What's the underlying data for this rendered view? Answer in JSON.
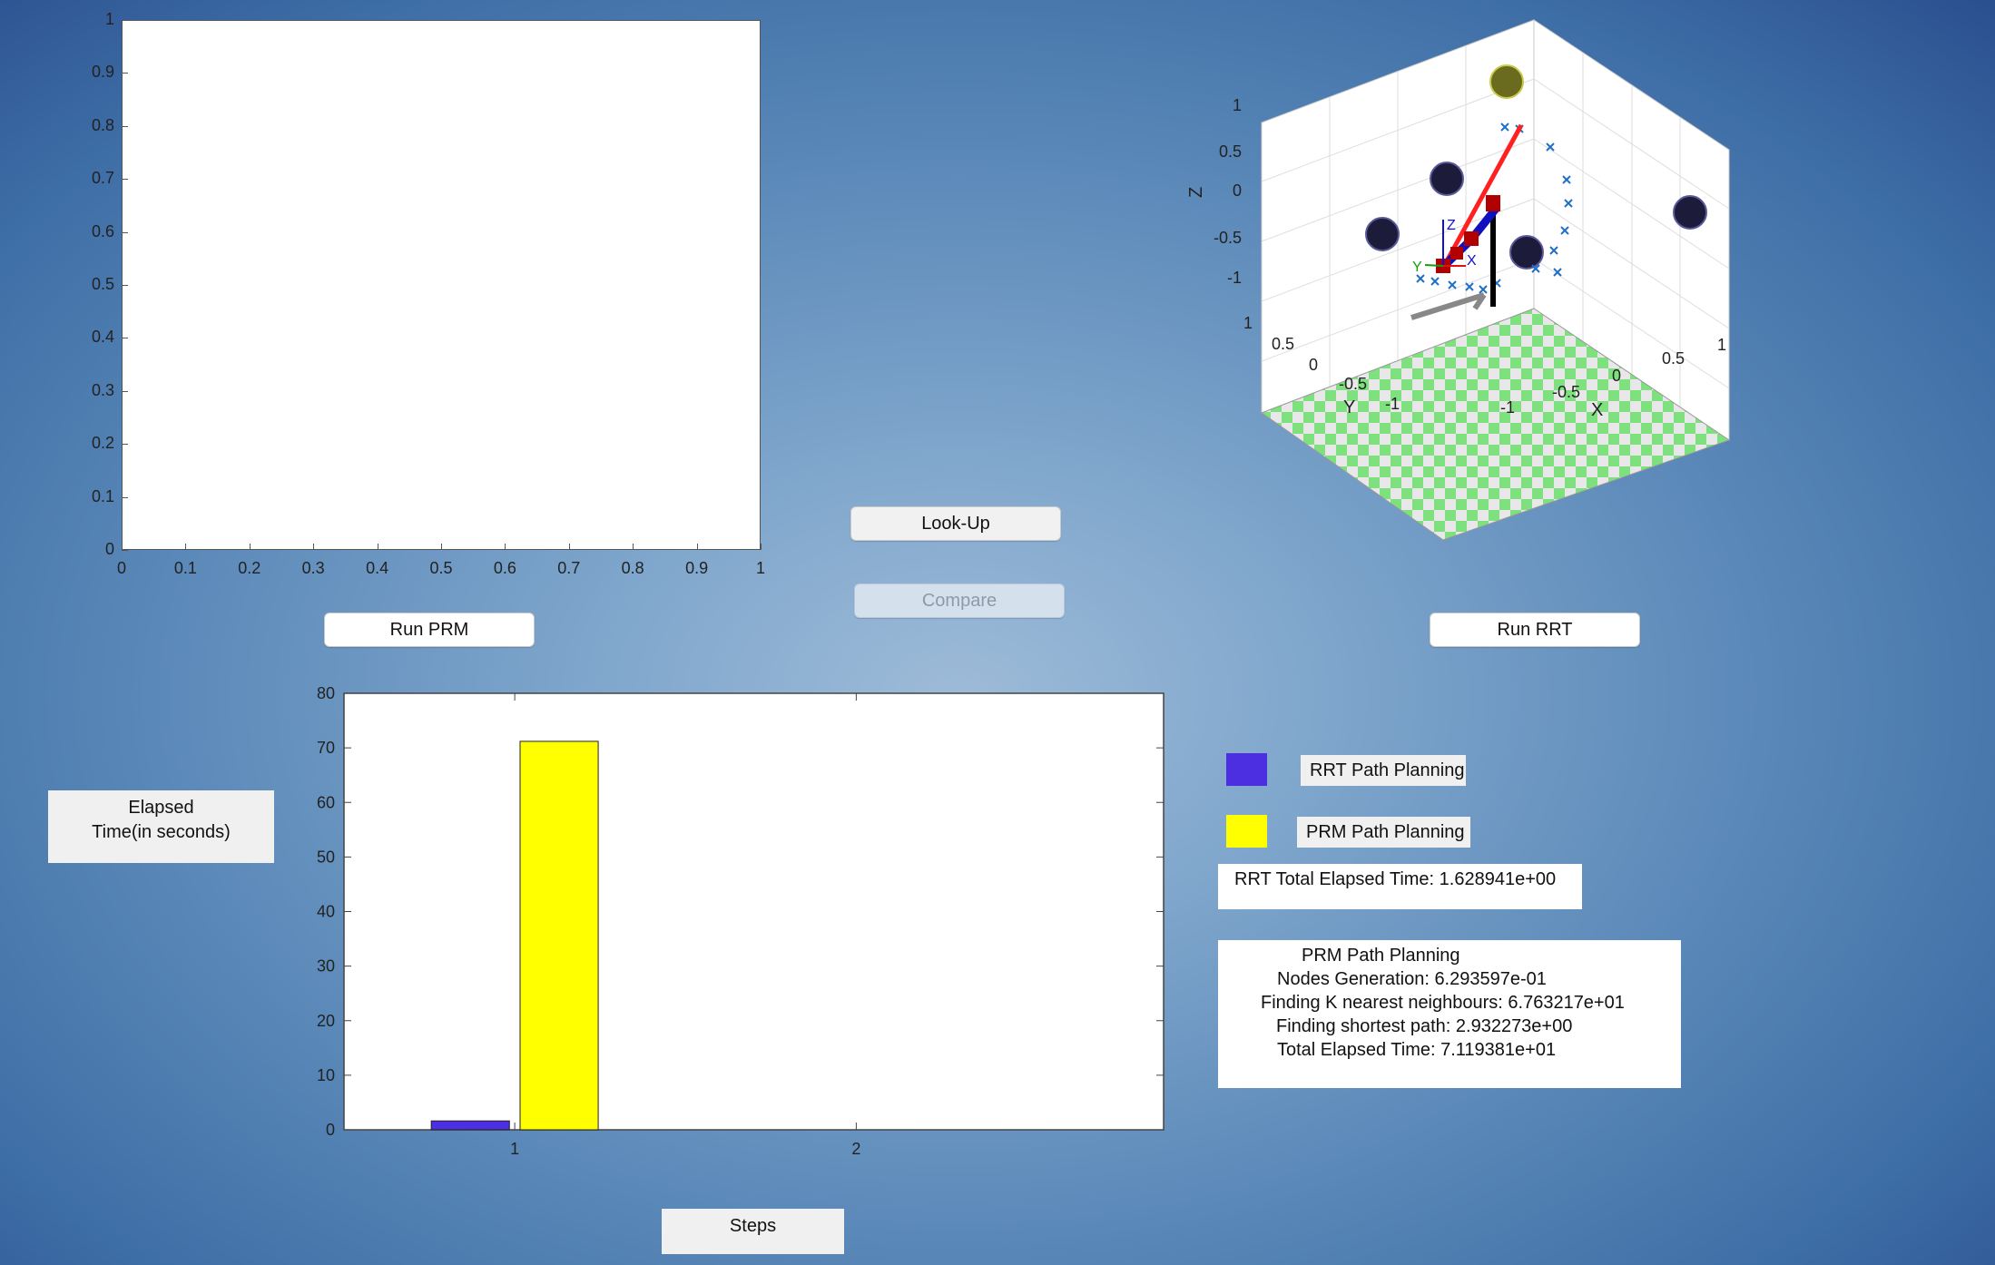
{
  "top_axes": {
    "chart_data": {
      "type": "line",
      "xlim": [
        0,
        1
      ],
      "ylim": [
        0,
        1
      ],
      "xticks": [
        "0",
        "0.1",
        "0.2",
        "0.3",
        "0.4",
        "0.5",
        "0.6",
        "0.7",
        "0.8",
        "0.9",
        "1"
      ],
      "yticks": [
        "0",
        "0.1",
        "0.2",
        "0.3",
        "0.4",
        "0.5",
        "0.6",
        "0.7",
        "0.8",
        "0.9",
        "1"
      ],
      "series": []
    }
  },
  "plot3d": {
    "zlabel": "Z",
    "ylabel": "Y",
    "xlabel": "X",
    "zticks": [
      "1",
      "0.5",
      "0",
      "-0.5",
      "-1"
    ],
    "yticks": [
      "1",
      "0.5",
      "0",
      "-0.5",
      "-1"
    ],
    "xticks": [
      "-1",
      "-0.5",
      "0",
      "0.5",
      "1"
    ],
    "frame_labels": {
      "z": "Z",
      "y": "Y",
      "x": "X"
    }
  },
  "buttons": {
    "run_prm": "Run PRM",
    "look_up": "Look-Up",
    "compare": "Compare",
    "run_rrt": "Run RRT"
  },
  "ylabel_panel": {
    "line1": "Elapsed",
    "line2": "Time(in seconds)"
  },
  "xlabel_panel": "Steps",
  "legend": [
    {
      "label": "RRT Path Planning",
      "color": "#4b2fe0"
    },
    {
      "label": "PRM Path Planning",
      "color": "#ffff00"
    }
  ],
  "rrt_total": "RRT Total Elapsed Time: 1.628941e+00",
  "prm_summary": {
    "title": "PRM Path Planning",
    "lines": [
      "Nodes Generation: 6.293597e-01",
      "Finding K nearest neighbours: 6.763217e+01",
      "Finding shortest path: 2.932273e+00",
      "Total Elapsed Time: 7.119381e+01"
    ]
  },
  "bar_chart": {
    "chart_data": {
      "type": "bar",
      "categories": [
        "1",
        "2"
      ],
      "ylim": [
        0,
        80
      ],
      "yticks": [
        "0",
        "10",
        "20",
        "30",
        "40",
        "50",
        "60",
        "70",
        "80"
      ],
      "series": [
        {
          "name": "RRT Path Planning",
          "values": [
            1.628941,
            0
          ],
          "color": "#4b2fe0"
        },
        {
          "name": "PRM Path Planning",
          "values": [
            71.19381,
            0
          ],
          "color": "#ffff00"
        }
      ]
    }
  }
}
